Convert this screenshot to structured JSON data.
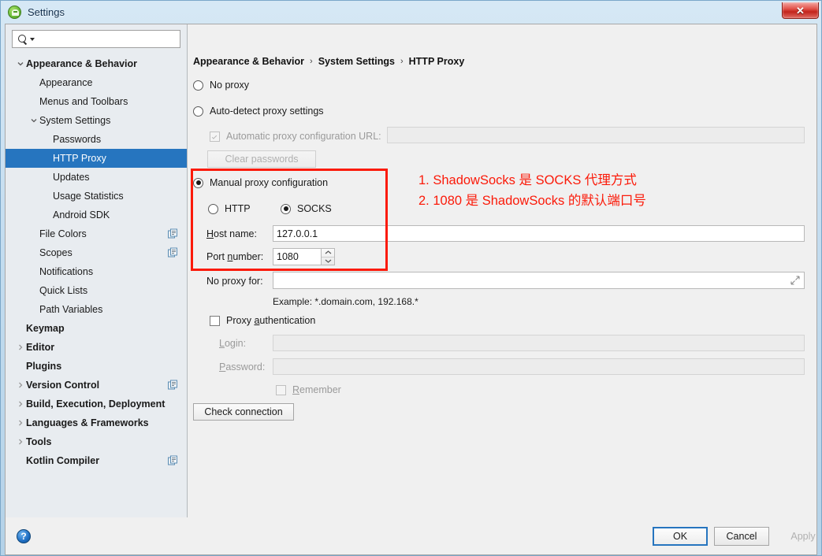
{
  "window": {
    "title": "Settings",
    "icon": "android-studio-icon",
    "close_label": "✕"
  },
  "sidebar": {
    "search": {
      "placeholder": "",
      "value": "",
      "icon": "search-icon"
    },
    "items": [
      {
        "label": "Appearance & Behavior",
        "indent": 0,
        "arrow": "down",
        "bold": true,
        "selected": false,
        "copy": false
      },
      {
        "label": "Appearance",
        "indent": 1,
        "arrow": "none",
        "bold": false,
        "selected": false,
        "copy": false
      },
      {
        "label": "Menus and Toolbars",
        "indent": 1,
        "arrow": "none",
        "bold": false,
        "selected": false,
        "copy": false
      },
      {
        "label": "System Settings",
        "indent": 1,
        "arrow": "down",
        "bold": false,
        "selected": false,
        "copy": false
      },
      {
        "label": "Passwords",
        "indent": 2,
        "arrow": "none",
        "bold": false,
        "selected": false,
        "copy": false
      },
      {
        "label": "HTTP Proxy",
        "indent": 2,
        "arrow": "none",
        "bold": false,
        "selected": true,
        "copy": false
      },
      {
        "label": "Updates",
        "indent": 2,
        "arrow": "none",
        "bold": false,
        "selected": false,
        "copy": false
      },
      {
        "label": "Usage Statistics",
        "indent": 2,
        "arrow": "none",
        "bold": false,
        "selected": false,
        "copy": false
      },
      {
        "label": "Android SDK",
        "indent": 2,
        "arrow": "none",
        "bold": false,
        "selected": false,
        "copy": false
      },
      {
        "label": "File Colors",
        "indent": 1,
        "arrow": "none",
        "bold": false,
        "selected": false,
        "copy": true
      },
      {
        "label": "Scopes",
        "indent": 1,
        "arrow": "none",
        "bold": false,
        "selected": false,
        "copy": true
      },
      {
        "label": "Notifications",
        "indent": 1,
        "arrow": "none",
        "bold": false,
        "selected": false,
        "copy": false
      },
      {
        "label": "Quick Lists",
        "indent": 1,
        "arrow": "none",
        "bold": false,
        "selected": false,
        "copy": false
      },
      {
        "label": "Path Variables",
        "indent": 1,
        "arrow": "none",
        "bold": false,
        "selected": false,
        "copy": false
      },
      {
        "label": "Keymap",
        "indent": 0,
        "arrow": "none",
        "bold": true,
        "selected": false,
        "copy": false
      },
      {
        "label": "Editor",
        "indent": 0,
        "arrow": "right",
        "bold": true,
        "selected": false,
        "copy": false
      },
      {
        "label": "Plugins",
        "indent": 0,
        "arrow": "none",
        "bold": true,
        "selected": false,
        "copy": false
      },
      {
        "label": "Version Control",
        "indent": 0,
        "arrow": "right",
        "bold": true,
        "selected": false,
        "copy": true
      },
      {
        "label": "Build, Execution, Deployment",
        "indent": 0,
        "arrow": "right",
        "bold": true,
        "selected": false,
        "copy": false
      },
      {
        "label": "Languages & Frameworks",
        "indent": 0,
        "arrow": "right",
        "bold": true,
        "selected": false,
        "copy": false
      },
      {
        "label": "Tools",
        "indent": 0,
        "arrow": "right",
        "bold": true,
        "selected": false,
        "copy": false
      },
      {
        "label": "Kotlin Compiler",
        "indent": 0,
        "arrow": "none",
        "bold": true,
        "selected": false,
        "copy": true
      }
    ]
  },
  "breadcrumb": {
    "items": [
      "Appearance & Behavior",
      "System Settings",
      "HTTP Proxy"
    ],
    "separator": "›"
  },
  "proxy": {
    "no_proxy": {
      "label": "No proxy",
      "checked": false
    },
    "auto_detect": {
      "label": "Auto-detect proxy settings",
      "checked": false
    },
    "auto_url": {
      "label": "Automatic proxy configuration URL:",
      "checked": true,
      "disabled": true,
      "value": ""
    },
    "clear_passwords": {
      "label": "Clear passwords",
      "disabled": true
    },
    "manual": {
      "label": "Manual proxy configuration",
      "checked": true
    },
    "http": {
      "label": "HTTP",
      "checked": false
    },
    "socks": {
      "label": "SOCKS",
      "checked": true
    },
    "host": {
      "label": "Host name:",
      "mnemonic": "H",
      "value": "127.0.0.1"
    },
    "port": {
      "label": "Port number:",
      "mnemonic": "n",
      "value": "1080"
    },
    "no_proxy_for": {
      "label": "No proxy for:",
      "value": "",
      "expand_icon": "expand-arrows-icon"
    },
    "example": "Example: *.domain.com, 192.168.*",
    "authentication": {
      "label": "Proxy authentication",
      "mnemonic": "a",
      "checked": false
    },
    "login": {
      "label": "Login:",
      "mnemonic": "L",
      "value": "",
      "disabled": true
    },
    "password": {
      "label": "Password:",
      "mnemonic": "P",
      "value": "",
      "disabled": true
    },
    "remember": {
      "label": "Remember",
      "mnemonic": "R",
      "checked": false,
      "disabled": true
    },
    "check_connection": {
      "label": "Check connection"
    }
  },
  "annotation": {
    "line1": "1. ShadowSocks 是 SOCKS 代理方式",
    "line2": "2. 1080 是 ShadowSocks 的默认端口号",
    "color": "#fb1a09"
  },
  "footer": {
    "help": "?",
    "ok": "OK",
    "cancel": "Cancel",
    "apply": "Apply"
  },
  "colors": {
    "selection": "#2675bf",
    "annotation_red": "#fb1a09",
    "panel_bg": "#f0f0f0",
    "sidebar_bg": "#e8ecf0"
  }
}
